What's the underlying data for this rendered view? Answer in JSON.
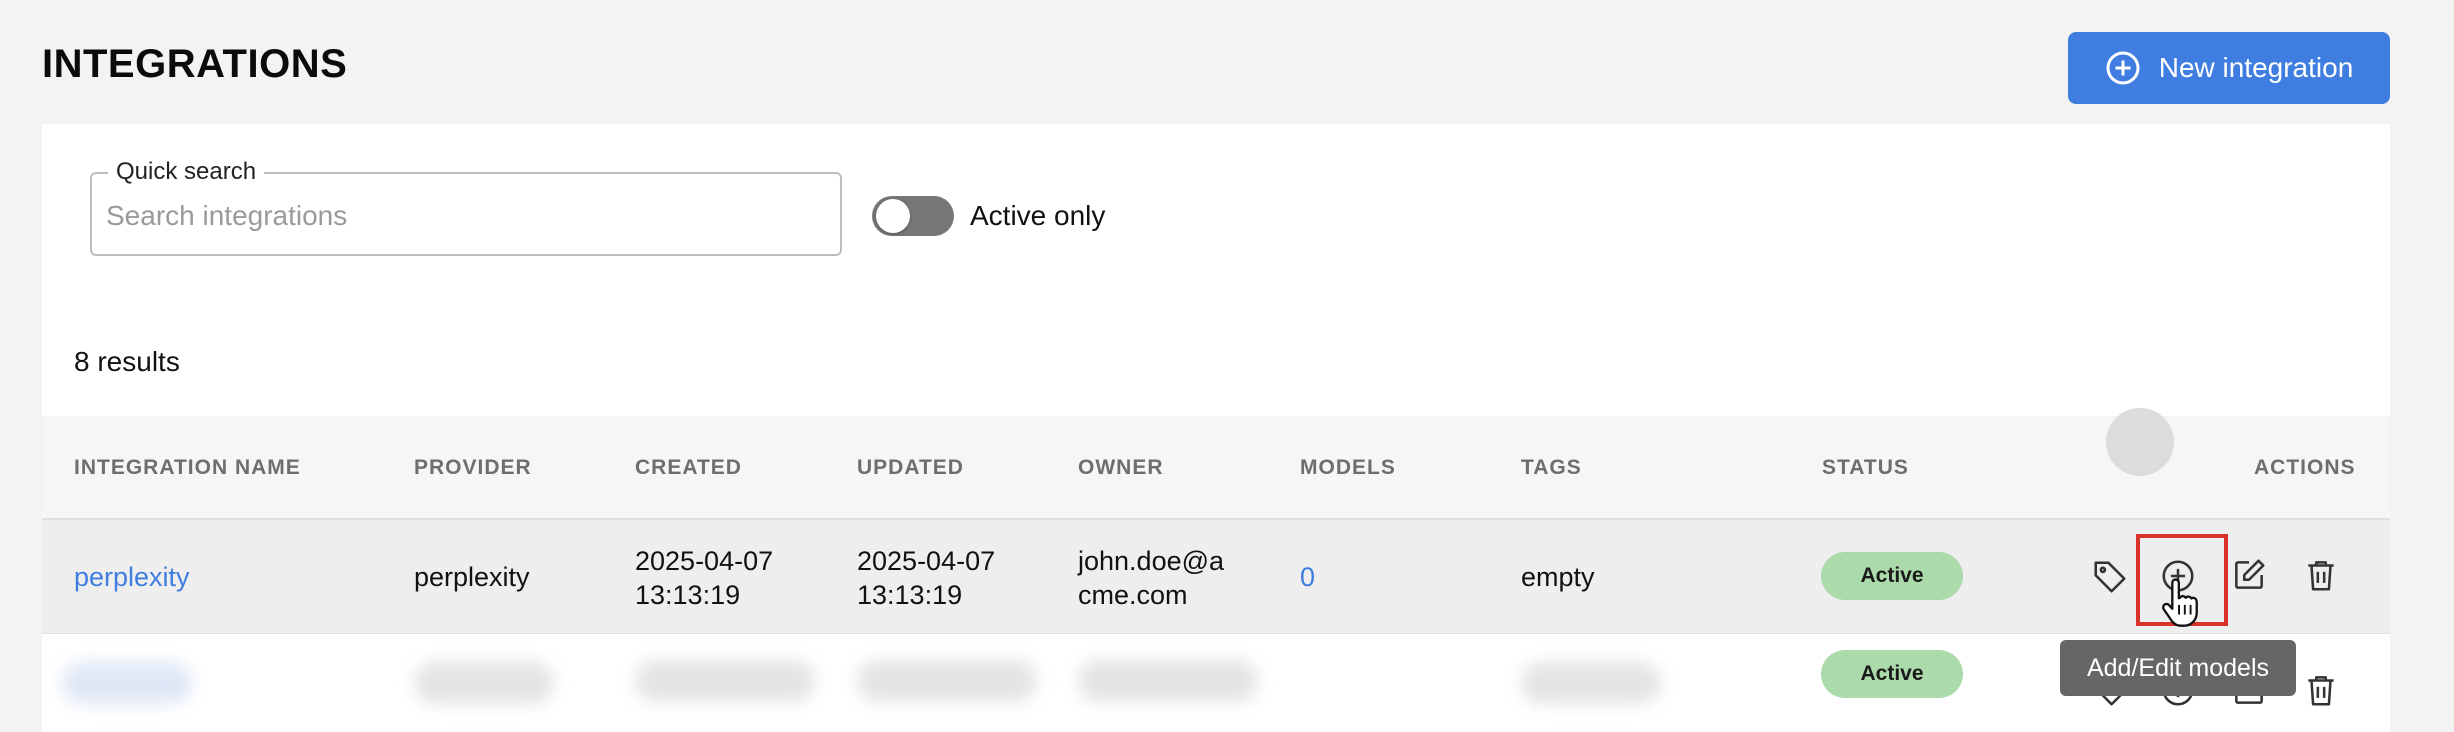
{
  "page": {
    "title": "INTEGRATIONS",
    "new_button_label": "New integration"
  },
  "filters": {
    "search_label": "Quick search",
    "search_placeholder": "Search integrations",
    "search_value": "",
    "active_only_label": "Active only",
    "active_only_on": false
  },
  "results_label": "8 results",
  "table": {
    "columns": [
      "INTEGRATION NAME",
      "PROVIDER",
      "CREATED",
      "UPDATED",
      "OWNER",
      "MODELS",
      "TAGS",
      "STATUS",
      "ACTIONS"
    ],
    "rows": [
      {
        "name": "perplexity",
        "provider": "perplexity",
        "created_date": "2025-04-07",
        "created_time": "13:13:19",
        "updated_date": "2025-04-07",
        "updated_time": "13:13:19",
        "owner_line1": "john.doe@a",
        "owner_line2": "cme.com",
        "models": "0",
        "tags": "empty",
        "status": "Active"
      },
      {
        "status": "Active"
      }
    ],
    "actions": [
      "tag-icon",
      "plus-circle-icon",
      "edit-icon",
      "trash-icon"
    ]
  },
  "tooltip": "Add/Edit models",
  "colors": {
    "accent": "#3f7ee0",
    "active_badge": "#abdaab",
    "highlight": "#d9322a"
  }
}
